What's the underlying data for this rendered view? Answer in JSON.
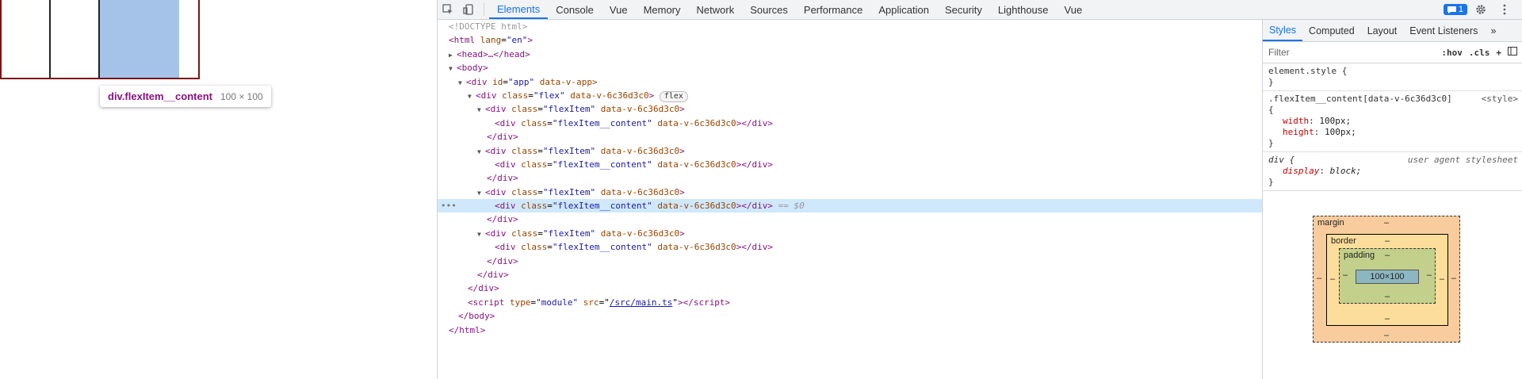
{
  "preview": {
    "tooltip_tag": "div.flexItem__content",
    "tooltip_dims": "100 × 100"
  },
  "toolbar": {
    "tabs": [
      "Elements",
      "Console",
      "Vue",
      "Memory",
      "Network",
      "Sources",
      "Performance",
      "Application",
      "Security",
      "Lighthouse",
      "Vue"
    ],
    "active_tab": "Elements",
    "issues_count": "1"
  },
  "dom": {
    "doctype": "<!DOCTYPE html>",
    "html_open_tag": "<html",
    "html_lang_attr": "lang",
    "html_lang_val": "\"en\"",
    "head": "<head>…</head>",
    "body_open": "<body>",
    "app_tag": "<div",
    "app_id_attr": "id",
    "app_id_val": "\"app\"",
    "app_data_attr": "data-v-app>",
    "flex_class_val": "\"flex\"",
    "scope_attr": "data-v-6c36d3c0",
    "flex_pill": "flex",
    "item_class_val": "\"flexItem\"",
    "content_class_val": "\"flexItem__content\"",
    "div_close": "</div>",
    "sel_marker": "== $0",
    "script_type_val": "\"module\"",
    "script_src_val": "/src/main.ts",
    "body_close": "</body>",
    "html_close": "</html>"
  },
  "styles": {
    "subtabs": [
      "Styles",
      "Computed",
      "Layout",
      "Event Listeners"
    ],
    "active_subtab": "Styles",
    "filter_placeholder": "Filter",
    "hov_label": ":hov",
    "cls_label": ".cls",
    "element_style": "element.style {",
    "rule1_selector": ".flexItem__content[data-v-6c36d3c0]",
    "rule1_source": "<style>",
    "rule1_props": [
      {
        "name": "width",
        "value": "100px;"
      },
      {
        "name": "height",
        "value": "100px;"
      }
    ],
    "rule2_selector": "div {",
    "rule2_source": "user agent stylesheet",
    "rule2_prop_name": "display",
    "rule2_prop_value": "block;",
    "open_brace": "{",
    "close_brace": "}"
  },
  "box_model": {
    "margin_label": "margin",
    "border_label": "border",
    "padding_label": "padding",
    "content": "100×100",
    "dash": "–"
  },
  "colors": {
    "accent": "#1a73e8",
    "selection": "#cfe8fc",
    "highlight": "#a5c3e8"
  }
}
